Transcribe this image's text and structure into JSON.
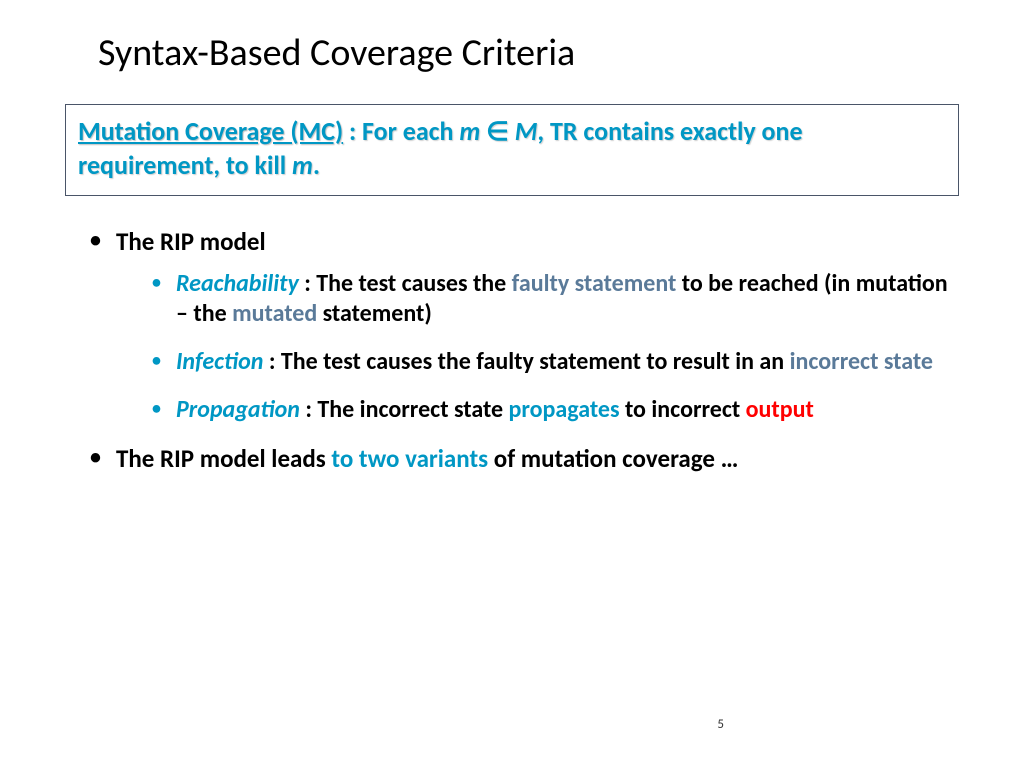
{
  "title": "Syntax-Based Coverage Criteria",
  "definition": {
    "label": "Mutation Coverage (MC)",
    "sep": " : ",
    "pre": "For each ",
    "m1": "m",
    "in_sym": " ∈ ",
    "m2": "M",
    "rest1": ", TR contains exactly one requirement, to kill ",
    "m3": "m",
    "period": "."
  },
  "top": {
    "item1": "The RIP model",
    "item2_pre": "The RIP model leads ",
    "item2_teal": "to two variants ",
    "item2_post": "of mutation coverage …"
  },
  "sub": {
    "reach": {
      "label": "Reachability",
      "sep": " : ",
      "t1": "The test causes the ",
      "h1": "faulty statement ",
      "t2": "to be reached (in mutation – the ",
      "h2": "mutated ",
      "t3": "statement)"
    },
    "inf": {
      "label": "Infection",
      "sep": " : ",
      "t1": "The test causes the faulty statement to result in an ",
      "h1": "incorrect state"
    },
    "prop": {
      "label": "Propagation",
      "sep": " : ",
      "t1": "The incorrect state ",
      "h1": "propagates ",
      "t2": "to incorrect ",
      "h2": "output"
    }
  },
  "pagenum": "5"
}
